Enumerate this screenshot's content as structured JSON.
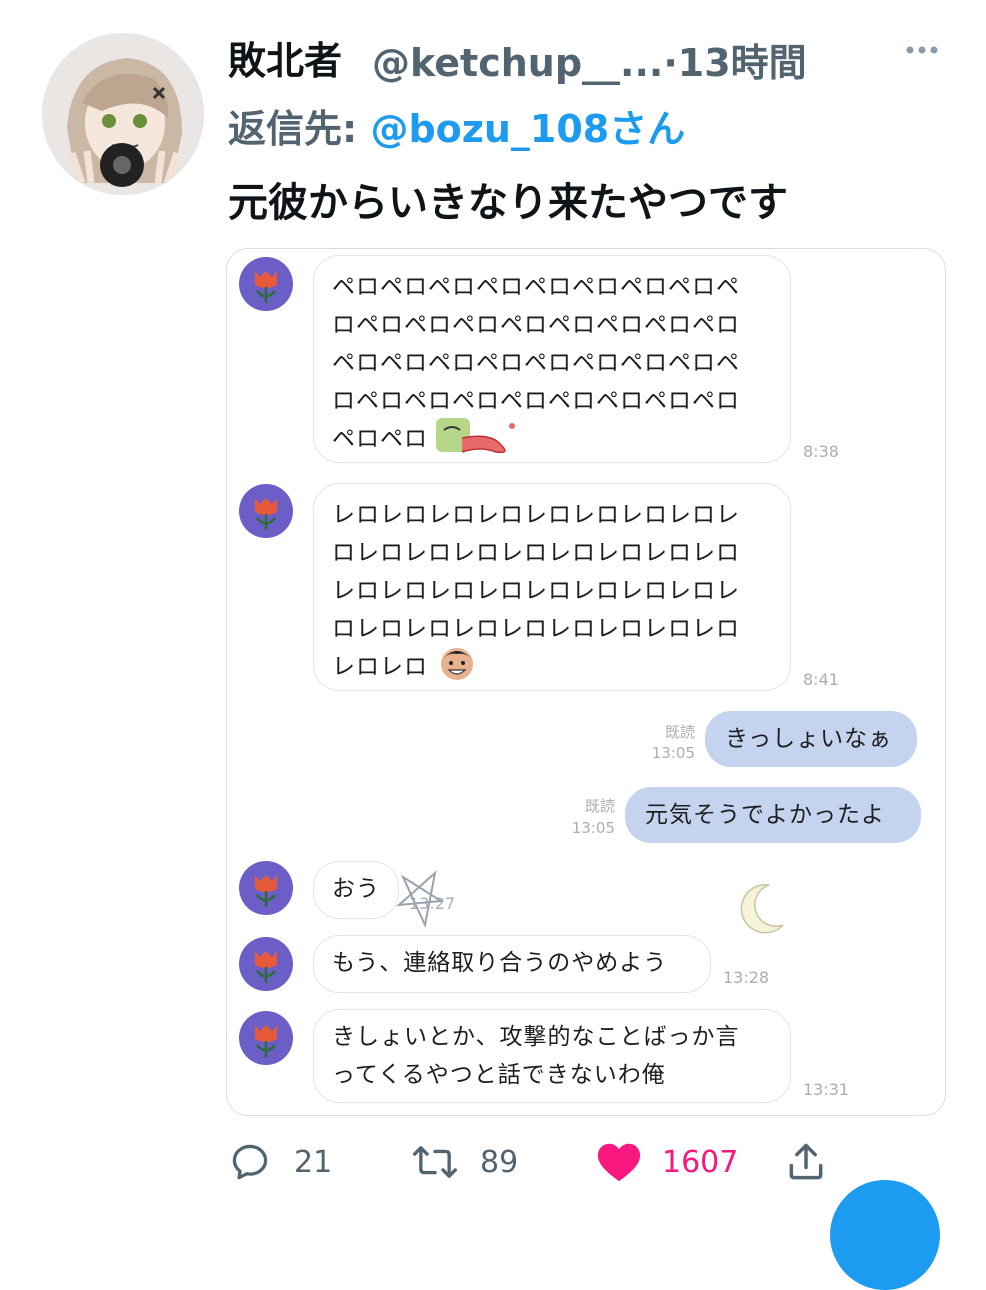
{
  "tweet": {
    "author_name": "敗北者",
    "handle": "@ketchup__...",
    "time_sep": "·",
    "time": "13時間",
    "more_icon": "ellipsis-icon",
    "reply_prefix": "返信先: ",
    "reply_to": "@bozu_108さん",
    "text": "元彼からいきなり来たやつです"
  },
  "chat": {
    "messages": [
      {
        "side": "in",
        "text": "ペロペロペロペロペロペロペロペロペ\nロペロペロペロペロペロペロペロペロ\nペロペロペロペロペロペロペロペロペ\nロペロペロペロペロペロペロペロペロ\nペロペロ",
        "emoji": "tongue-face-emoji",
        "time": "8:38"
      },
      {
        "side": "in",
        "text": "レロレロレロレロレロレロレロレロレ\nロレロレロレロレロレロレロレロレロ\nレロレロレロレロレロレロレロレロレ\nロレロレロレロレロレロレロレロレロ\nレロレロ",
        "emoji": "grinning-face-emoji",
        "time": "8:41"
      },
      {
        "side": "out",
        "text": "きっしょいなぁ",
        "read": "既読",
        "time": "13:05"
      },
      {
        "side": "out",
        "text": "元気そうでよかったよ",
        "read": "既読",
        "time": "13:05"
      },
      {
        "side": "in",
        "text": "おう",
        "time": "13:27"
      },
      {
        "side": "in",
        "text": "もう、連絡取り合うのやめよう",
        "time": "13:28"
      },
      {
        "side": "in",
        "text": "きしょいとか、攻撃的なことばっか言\nってくるやつと話できないわ俺",
        "time": "13:31"
      }
    ]
  },
  "actions": {
    "reply_count": "21",
    "retweet_count": "89",
    "like_count": "1607",
    "colors": {
      "like": "#f91880",
      "link": "#1d9bf0",
      "bubble_out": "#c4d3ee",
      "avatar_bg": "#6b5fc7"
    }
  }
}
